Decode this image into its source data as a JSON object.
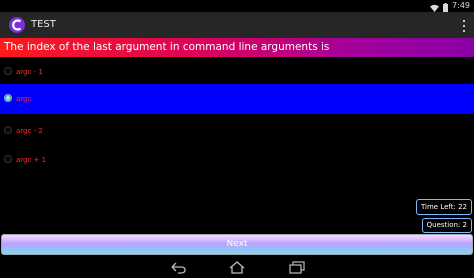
{
  "status": {
    "time": "7:49"
  },
  "app": {
    "title": "TEST",
    "icon": "app-c-logo-icon",
    "accent": "#8a2be2"
  },
  "question": {
    "text": "The index of the last argument in command line arguments is",
    "gradient": [
      "#ff1a1a",
      "#8a00a8"
    ]
  },
  "options": [
    {
      "label": "argc - 1",
      "selected": false
    },
    {
      "label": "argc",
      "selected": true
    },
    {
      "label": "argc - 2",
      "selected": false
    },
    {
      "label": "argc + 1",
      "selected": false
    }
  ],
  "selected_color": "#0000ff",
  "info": {
    "time_left": "Time Left: 22",
    "question_num": "Question: 2"
  },
  "next_label": "Next",
  "nav": {
    "back_icon": "back-icon",
    "home_icon": "home-icon",
    "recents_icon": "recents-icon"
  }
}
